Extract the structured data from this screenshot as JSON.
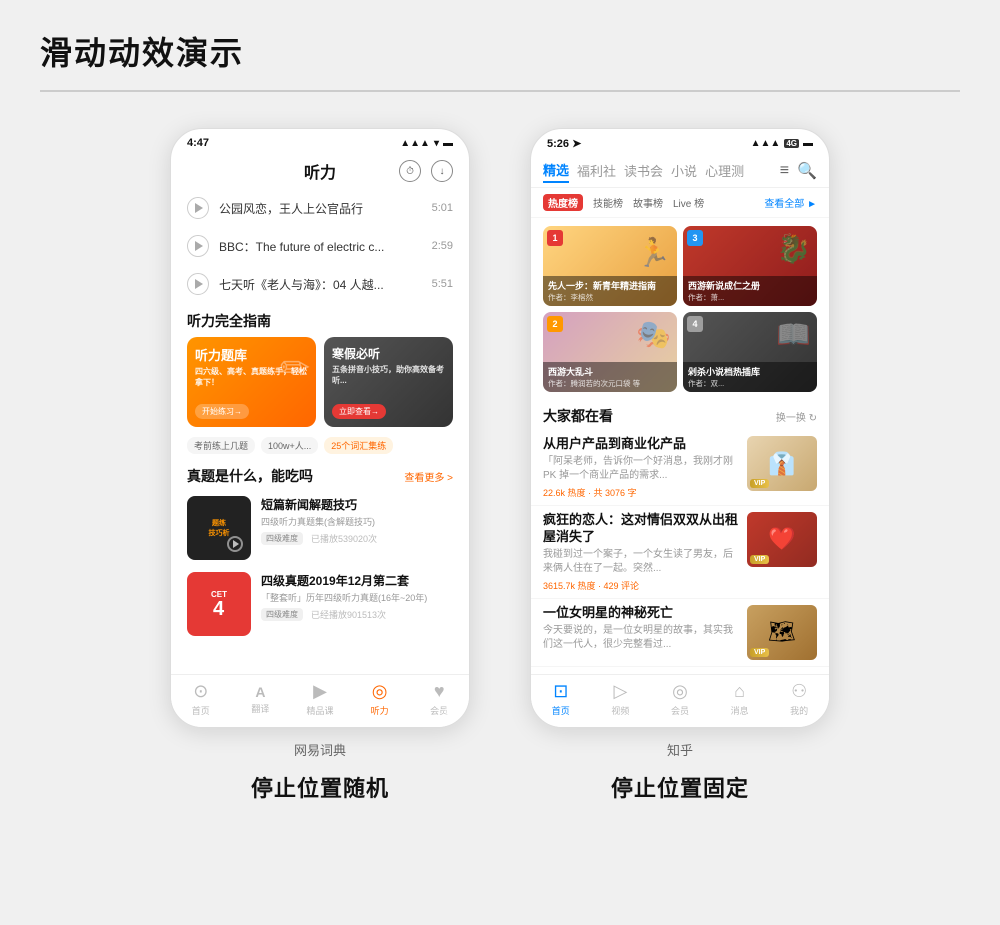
{
  "page": {
    "title": "滑动动效演示"
  },
  "left_phone": {
    "status": {
      "time": "4:47",
      "signal": "▲▲▲",
      "wifi": "WiFi",
      "battery": "🔋"
    },
    "nav_title": "听力",
    "list_items": [
      {
        "title": "公园风恋，王人上公官品行",
        "time": "5:01"
      },
      {
        "title": "BBC：The future of electric c...",
        "time": "2:59"
      },
      {
        "title": "七天听《老人与海》：04 人越...",
        "time": "5:51"
      }
    ],
    "section_heading": "听力完全指南",
    "banner1": {
      "title": "听力题库",
      "subtitle": "四六级、高考、真题练手，轻松拿下！",
      "btn": "开始练习→"
    },
    "banner2": {
      "title": "寒假必听",
      "subtitle": "五条拼音小技巧，助你高效备考听...",
      "btn": "立即查看→"
    },
    "tags": [
      "考前练上几题",
      "100w+人...",
      "25个词汇集练"
    ],
    "section2": {
      "title": "真题是什么，能吃吗",
      "more": "查看更多 >"
    },
    "course1": {
      "title": "短篇新闻解题技巧",
      "desc": "四级听力真题集(含解题技巧)",
      "difficulty": "四级难度",
      "plays": "已播放539020次",
      "tag": "题练技巧析"
    },
    "course2": {
      "title": "四级真题2019年12月第二套",
      "desc": "「整套听」历年四级听力真题(16年~20年)",
      "difficulty": "四级难度",
      "plays": "已经播放901513次",
      "cet_label": "CET 4"
    },
    "bottom_tabs": [
      {
        "icon": "⊙",
        "label": "首页",
        "active": false
      },
      {
        "icon": "A",
        "label": "翻译",
        "active": false
      },
      {
        "icon": "▶",
        "label": "精品课",
        "active": false
      },
      {
        "icon": "◎",
        "label": "听力",
        "active": true
      },
      {
        "icon": "♥",
        "label": "会员",
        "active": false
      }
    ],
    "label": "网易词典",
    "caption": "停止位置随机"
  },
  "right_phone": {
    "status": {
      "time": "5:26",
      "signal": "▲▲▲",
      "network": "4G",
      "battery": "🔋"
    },
    "top_tabs": [
      {
        "label": "精选",
        "active": true
      },
      {
        "label": "福利社",
        "active": false
      },
      {
        "label": "读书会",
        "active": false
      },
      {
        "label": "小说",
        "active": false
      },
      {
        "label": "心理测",
        "active": false
      }
    ],
    "hot_tabs": [
      {
        "label": "热度榜",
        "active": true,
        "type": "badge"
      },
      {
        "label": "技能榜",
        "active": false
      },
      {
        "label": "故事榜",
        "active": false
      },
      {
        "label": "Live 榜",
        "active": false
      }
    ],
    "see_all": "查看全部 ►",
    "books": [
      {
        "rank": "1",
        "title": "先人一步：新青年精进指南",
        "author": "作者：李榕然",
        "color": "c1"
      },
      {
        "rank": "3",
        "title": "西游新说成仁之册",
        "author": "作者：萧...",
        "color": "c2"
      },
      {
        "rank": "2",
        "title": "西游大乱斗",
        "author": "作者：腾润若的次元口袋 等",
        "color": "c3"
      },
      {
        "rank": "4",
        "title": "剁杀小说档热插库",
        "author": "作者：双...",
        "color": "c4"
      }
    ],
    "section": {
      "title": "大家都在看",
      "refresh": "换一换 ↻"
    },
    "feeds": [
      {
        "title": "从用户产品到商业化产品",
        "excerpt": "「阿呆老师，告诉你一个好消息，我刚才刚 PK 掉一个商业产品的需求...",
        "hot": "22.6k 热度 · 共 3076 字",
        "has_img": true,
        "img_color": "#e8d4c0",
        "has_vip": true
      },
      {
        "title": "疯狂的恋人：这对情侣双双从出租屋消失了",
        "excerpt": "我碰到过一个案子，一个女生读了男友，后来俩人住在了一起。突然...",
        "hot": "3615.7k 热度 · 429 评论",
        "has_img": true,
        "img_color": "#c0392b",
        "has_vip": true
      },
      {
        "title": "一位女明星的神秘死亡",
        "excerpt": "今天要说的，是一位女明星的故事，其实我们这一代人，很少完整看过...",
        "hot": "",
        "has_img": true,
        "img_color": "#c8a060",
        "has_vip": true
      }
    ],
    "bottom_tabs": [
      {
        "icon": "⬜",
        "label": "首页",
        "active": true
      },
      {
        "icon": "▷",
        "label": "视频",
        "active": false
      },
      {
        "icon": "📷",
        "label": "会员",
        "active": false
      },
      {
        "icon": "🏠",
        "label": "消息",
        "active": false
      },
      {
        "icon": "👤",
        "label": "我的",
        "active": false
      }
    ],
    "label": "知乎",
    "caption": "停止位置固定"
  }
}
